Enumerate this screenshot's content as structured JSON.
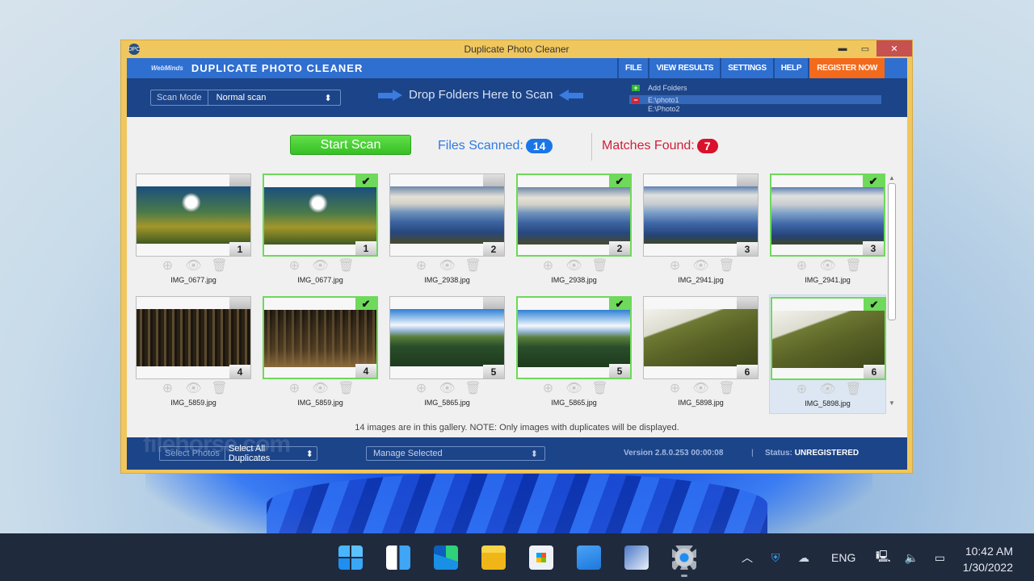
{
  "window": {
    "title": "Duplicate Photo Cleaner",
    "controls": {
      "minimize": "▬",
      "maximize": "▭",
      "close": "✕"
    }
  },
  "header": {
    "brand_small": "WebMinds",
    "brand": "DUPLICATE PHOTO CLEANER",
    "menu": [
      "FILE",
      "VIEW RESULTS",
      "SETTINGS",
      "HELP",
      "REGISTER NOW"
    ]
  },
  "toolbar": {
    "scan_mode_label": "Scan Mode",
    "scan_mode_value": "Normal scan",
    "drop_text": "Drop Folders Here to Scan",
    "add_folders": "Add Folders",
    "folders": [
      "E:\\photo1",
      "E:\\Photo2"
    ]
  },
  "scan": {
    "start_label": "Start Scan",
    "files_scanned_label": "Files Scanned:",
    "files_scanned": "14",
    "matches_label": "Matches Found:",
    "matches": "7"
  },
  "gallery": {
    "tiles": [
      {
        "file": "IMG_0677.jpg",
        "group": "1",
        "checked": false,
        "photo": "dandelion"
      },
      {
        "file": "IMG_0677.jpg",
        "group": "1",
        "checked": true,
        "photo": "dandelion"
      },
      {
        "file": "IMG_2938.jpg",
        "group": "2",
        "checked": false,
        "photo": "mountain"
      },
      {
        "file": "IMG_2938.jpg",
        "group": "2",
        "checked": true,
        "photo": "mountain"
      },
      {
        "file": "IMG_2941.jpg",
        "group": "3",
        "checked": false,
        "photo": "mountain2"
      },
      {
        "file": "IMG_2941.jpg",
        "group": "3",
        "checked": true,
        "photo": "mountain2"
      },
      {
        "file": "IMG_5859.jpg",
        "group": "4",
        "checked": false,
        "photo": "forest"
      },
      {
        "file": "IMG_5859.jpg",
        "group": "4",
        "checked": true,
        "photo": "forest-b"
      },
      {
        "file": "IMG_5865.jpg",
        "group": "5",
        "checked": false,
        "photo": "hills"
      },
      {
        "file": "IMG_5865.jpg",
        "group": "5",
        "checked": true,
        "photo": "hills"
      },
      {
        "file": "IMG_5898.jpg",
        "group": "6",
        "checked": false,
        "photo": "slope"
      },
      {
        "file": "IMG_5898.jpg",
        "group": "6",
        "checked": true,
        "photo": "slope"
      }
    ],
    "note": "14 images are in this gallery. NOTE: Only images with duplicates will be displayed."
  },
  "footer": {
    "select_photos_label": "Select Photos",
    "select_photos_value": "Select All Duplicates",
    "manage_value": "Manage Selected",
    "version": "Version 2.8.0.253 00:00:08",
    "separator": "|",
    "status_label": "Status:",
    "status_value": "UNREGISTERED",
    "watermark": "filehorse.com"
  },
  "taskbar": {
    "apps": [
      "Start",
      "Widgets",
      "Microsoft Edge",
      "File Explorer",
      "Microsoft Store",
      "Mail",
      "Paint",
      "Settings"
    ],
    "language": "ENG",
    "time": "10:42 AM",
    "date": "1/30/2022"
  }
}
